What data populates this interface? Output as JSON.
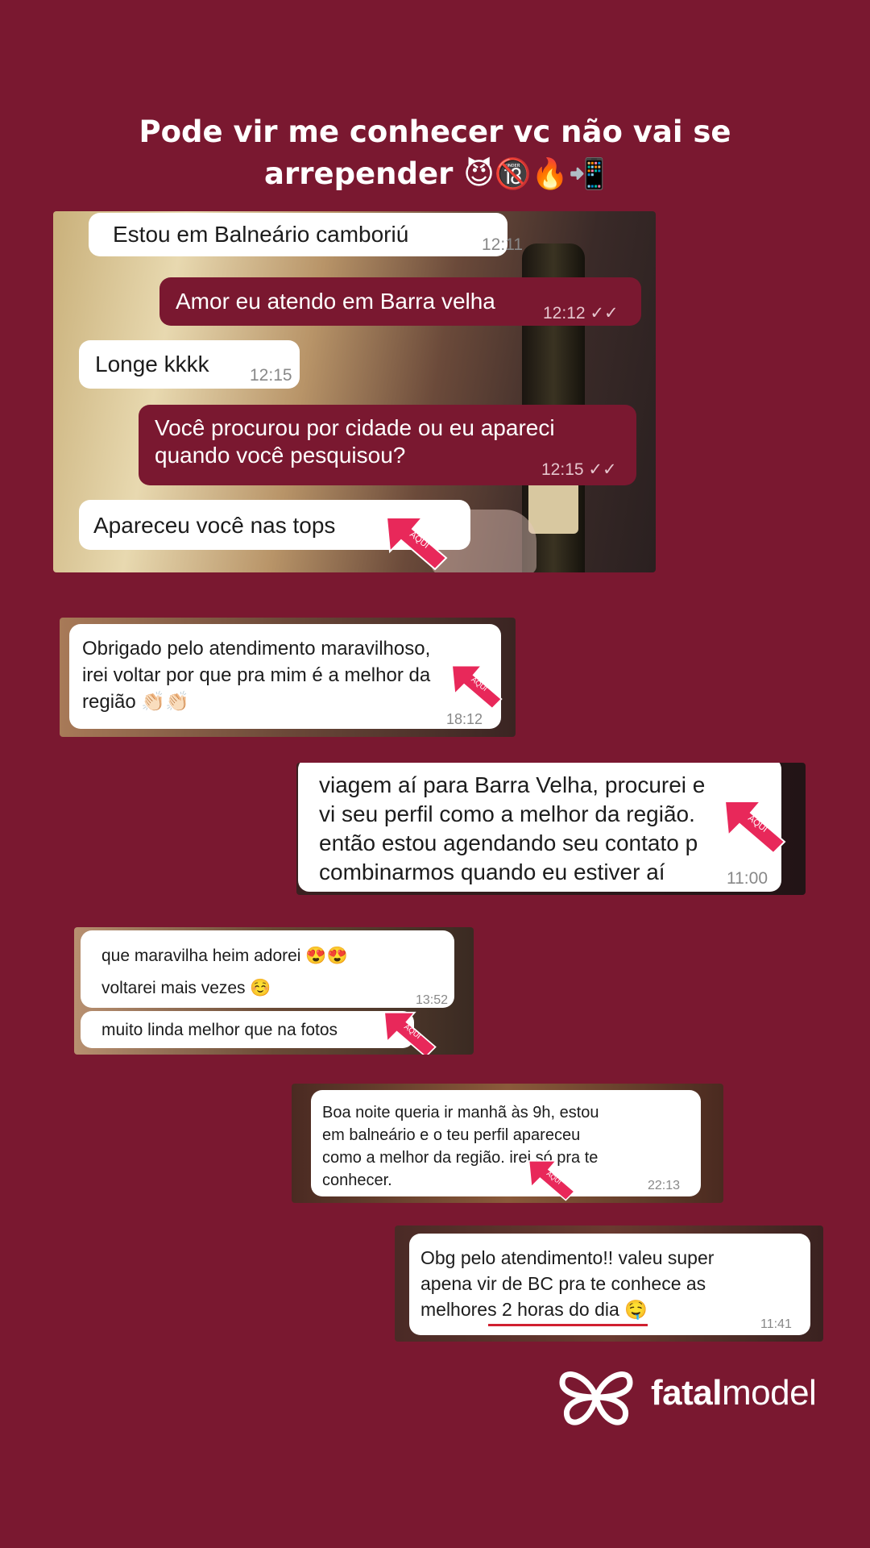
{
  "header": {
    "line1": "Pode vir me conhecer vc não vai se",
    "line2": "arrepender 😈🔞🔥📲"
  },
  "arrow_label": "AQUI",
  "chat1": {
    "m1": {
      "text": "Estou em Balneário camboriú",
      "time": "12:11"
    },
    "m2": {
      "text": "Amor eu atendo em Barra velha",
      "time": "12:12 ✓✓"
    },
    "m3": {
      "text": "Longe kkkk",
      "time": "12:15"
    },
    "m4": {
      "text": "Você procurou por cidade ou eu apareci\nquando você pesquisou?",
      "time": "12:15 ✓✓"
    },
    "m5": {
      "text": "Apareceu você nas tops"
    }
  },
  "chat2": {
    "text": "Obrigado pelo atendimento maravilhoso,\nirei voltar por que pra mim é a melhor da\nregião 👏🏻👏🏻",
    "time": "18:12"
  },
  "chat3": {
    "text": "viagem aí para Barra Velha, procurei e\nvi seu perfil como a melhor da região.\nentão estou agendando seu contato p\ncombinarmos quando eu estiver aí",
    "time": "11:00"
  },
  "chat4": {
    "m1": {
      "text": "que maravilha heim adorei 😍😍\nvoltarei mais vezes ☺️",
      "time": "13:52"
    },
    "m2": {
      "text": "muito linda melhor que na fotos"
    }
  },
  "chat5": {
    "text": "Boa noite queria ir manhã às 9h, estou\nem balneário e o teu perfil apareceu\ncomo a melhor da região. irei só pra te\nconhecer.",
    "time": "22:13"
  },
  "chat6": {
    "text": "Obg pelo atendimento!! valeu super\napena vir de BC pra te conhece as\nmelhores 2 horas do dia 🤤",
    "time": "11:41"
  },
  "brand": {
    "bold": "fatal",
    "rest": "model"
  },
  "colors": {
    "background": "#7a1830",
    "arrow": "#e8285a",
    "bubble_out": "#7a1830"
  }
}
